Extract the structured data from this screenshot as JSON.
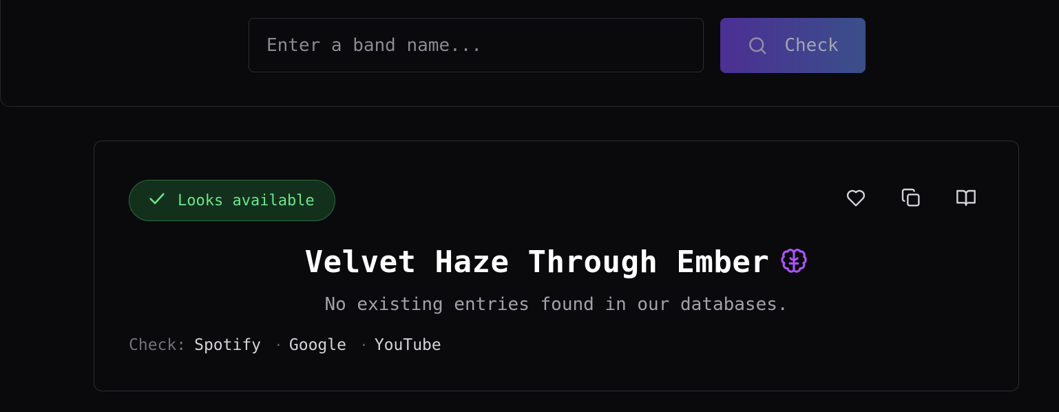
{
  "search": {
    "placeholder": "Enter a band name...",
    "value": "",
    "button_label": "Check"
  },
  "result": {
    "status": "Looks available",
    "band_name": "Velvet Haze Through Ember",
    "message": "No existing entries found in our databases.",
    "links_label": "Check:",
    "links": [
      "Spotify",
      "Google",
      "YouTube"
    ],
    "separator": "·"
  },
  "colors": {
    "accent_gradient_start": "#4c2f94",
    "accent_gradient_end": "#3a4f8a",
    "available_green": "#6ee38a",
    "brain_icon": "#a855f7"
  },
  "icons": {
    "search_button": "search-icon",
    "status": "check-icon",
    "actions": [
      "heart-icon",
      "copy-icon",
      "book-open-icon"
    ],
    "title_badge": "brain-icon"
  }
}
